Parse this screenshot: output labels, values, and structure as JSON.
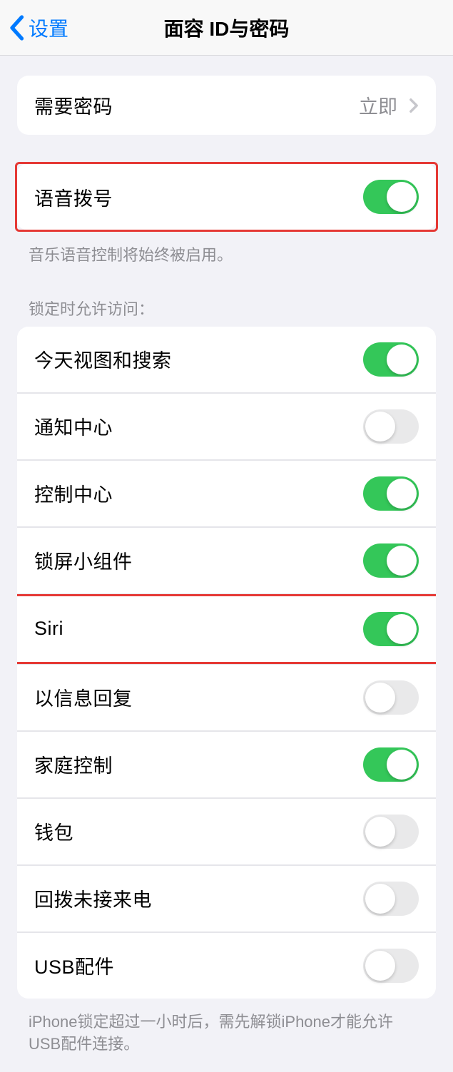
{
  "navbar": {
    "back_label": "设置",
    "title": "面容 ID与密码"
  },
  "require_passcode": {
    "label": "需要密码",
    "value": "立即"
  },
  "voice_dial": {
    "label": "语音拨号",
    "toggle_on": true,
    "footer": "音乐语音控制将始终被启用。"
  },
  "lock_section": {
    "header": "锁定时允许访问：",
    "items": [
      {
        "label": "今天视图和搜索",
        "on": true,
        "highlighted": false
      },
      {
        "label": "通知中心",
        "on": false,
        "highlighted": false
      },
      {
        "label": "控制中心",
        "on": true,
        "highlighted": false
      },
      {
        "label": "锁屏小组件",
        "on": true,
        "highlighted": false
      },
      {
        "label": "Siri",
        "on": true,
        "highlighted": true
      },
      {
        "label": "以信息回复",
        "on": false,
        "highlighted": false
      },
      {
        "label": "家庭控制",
        "on": true,
        "highlighted": false
      },
      {
        "label": "钱包",
        "on": false,
        "highlighted": false
      },
      {
        "label": "回拨未接来电",
        "on": false,
        "highlighted": false
      },
      {
        "label": "USB配件",
        "on": false,
        "highlighted": false
      }
    ],
    "footer": "iPhone锁定超过一小时后，需先解锁iPhone才能允许USB配件连接。"
  }
}
